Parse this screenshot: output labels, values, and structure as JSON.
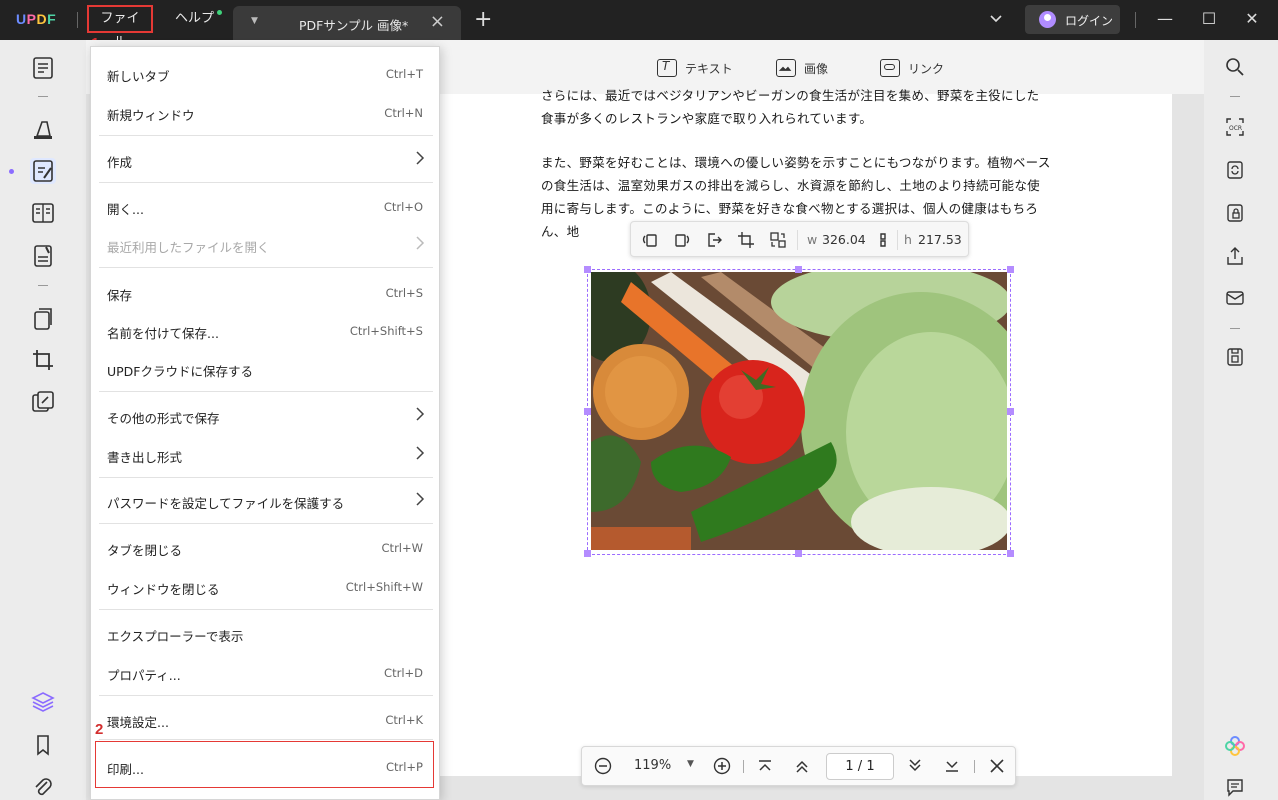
{
  "app": {
    "logo": "UPDF"
  },
  "menubar": {
    "file": "ファイル",
    "help": "ヘルプ"
  },
  "tab": {
    "title": "PDFサンプル 画像*"
  },
  "account": {
    "login": "ログイン"
  },
  "edit_toolbar": {
    "text": "テキスト",
    "image": "画像",
    "link": "リンク"
  },
  "document": {
    "paragraphs": [
      "さらには、最近ではベジタリアンやビーガンの食生活が注目を集め、野菜を主役にした食事が多くのレストランや家庭で取り入れられています。",
      "また、野菜を好むことは、環境への優しい姿勢を示すことにもつながります。植物ベースの食生活は、温室効果ガスの排出を減らし、水資源を節約し、土地のより持続可能な使用に寄与します。このように、野菜を好きな食べ物とする選択は、個人の健康はもちろん、地"
    ]
  },
  "image_toolbar": {
    "w_label": "w",
    "w_value": "326.04",
    "h_label": "h",
    "h_value": "217.53"
  },
  "zoom": {
    "value": "119%",
    "page": "1 / 1"
  },
  "file_menu": {
    "items": [
      {
        "label": "新しいタブ",
        "shortcut": "Ctrl+T"
      },
      {
        "label": "新規ウィンドウ",
        "shortcut": "Ctrl+N"
      },
      {
        "label": "作成",
        "shortcut": ""
      },
      {
        "label": "開く...",
        "shortcut": "Ctrl+O"
      },
      {
        "label": "最近利用したファイルを開く",
        "shortcut": ""
      },
      {
        "label": "保存",
        "shortcut": "Ctrl+S"
      },
      {
        "label": "名前を付けて保存...",
        "shortcut": "Ctrl+Shift+S"
      },
      {
        "label": "UPDFクラウドに保存する",
        "shortcut": ""
      },
      {
        "label": "その他の形式で保存",
        "shortcut": ""
      },
      {
        "label": "書き出し形式",
        "shortcut": ""
      },
      {
        "label": "パスワードを設定してファイルを保護する",
        "shortcut": ""
      },
      {
        "label": "タブを閉じる",
        "shortcut": "Ctrl+W"
      },
      {
        "label": "ウィンドウを閉じる",
        "shortcut": "Ctrl+Shift+W"
      },
      {
        "label": "エクスプローラーで表示",
        "shortcut": ""
      },
      {
        "label": "プロパティ...",
        "shortcut": "Ctrl+D"
      },
      {
        "label": "環境設定...",
        "shortcut": "Ctrl+K"
      },
      {
        "label": "印刷...",
        "shortcut": "Ctrl+P"
      }
    ]
  },
  "annotations": {
    "step1": "1",
    "step2": "2"
  },
  "colors": {
    "highlight": "#e53935",
    "selection": "#9b6bff",
    "titlebar": "#222222"
  }
}
